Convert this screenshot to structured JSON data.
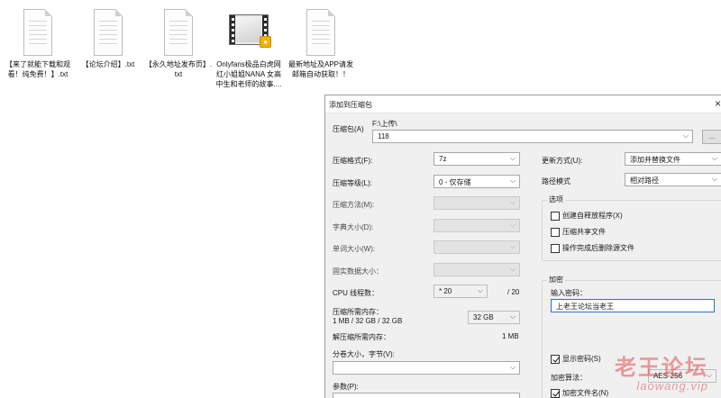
{
  "desktop": {
    "files": [
      {
        "name": "【来了就能下载和观看！纯免费！】.txt",
        "type": "txt"
      },
      {
        "name": "【论坛介绍】.txt",
        "type": "txt"
      },
      {
        "name": "【永久地址发布页】.txt",
        "type": "txt"
      },
      {
        "name": "Onlyfans极品白虎网红小姐姐NANA 女高中生和老师的故事....",
        "type": "video"
      },
      {
        "name": "最新地址及APP请发邮箱自动获取！！",
        "type": "txt"
      }
    ]
  },
  "dialog": {
    "title": "添加到压缩包",
    "close": "×",
    "archive_label": "压缩包(A)",
    "archive_path": "F:\\上传\\",
    "archive_name": "118",
    "browse_button": "...",
    "left": {
      "format_label": "压缩格式(F):",
      "format_value": "7z",
      "level_label": "压缩等级(L):",
      "level_value": "0 - 仅存储",
      "method_label": "压缩方法(M):",
      "dict_label": "字典大小(D):",
      "word_label": "单词大小(W):",
      "solid_label": "固实数据大小：",
      "cpu_label": "CPU 线程数：",
      "cpu_value": "* 20",
      "cpu_max": "/ 20",
      "mem_label": "压缩所需内存：",
      "mem_detail": "1 MB / 32 GB / 32 GB",
      "mem_value": "32 GB",
      "decomp_label": "解压缩所需内存：",
      "decomp_value": "1 MB",
      "split_label": "分卷大小，字节(V):",
      "params_label": "参数(P):"
    },
    "right": {
      "update_label": "更新方式(U):",
      "update_value": "添加并替换文件",
      "path_label": "路径模式",
      "path_value": "相对路径",
      "options_title": "选项",
      "opt_sfx": "创建自释放程序(X)",
      "opt_shared": "压缩共享文件",
      "opt_delete": "操作完成后删除源文件",
      "enc_title": "加密",
      "pwd_label": "输入密码：",
      "pwd_value": "上老王论坛当老王",
      "show_pwd": "显示密码(S)",
      "algo_label": "加密算法：",
      "algo_value": "AES-256",
      "enc_names": "加密文件名(N)"
    }
  },
  "watermark": {
    "text": "老王论坛",
    "url": "laowang.vip"
  },
  "icons": {
    "chevron": "chevron-down-icon",
    "txt": "text-file-icon",
    "video": "video-file-icon",
    "check": "checkmark-icon"
  }
}
